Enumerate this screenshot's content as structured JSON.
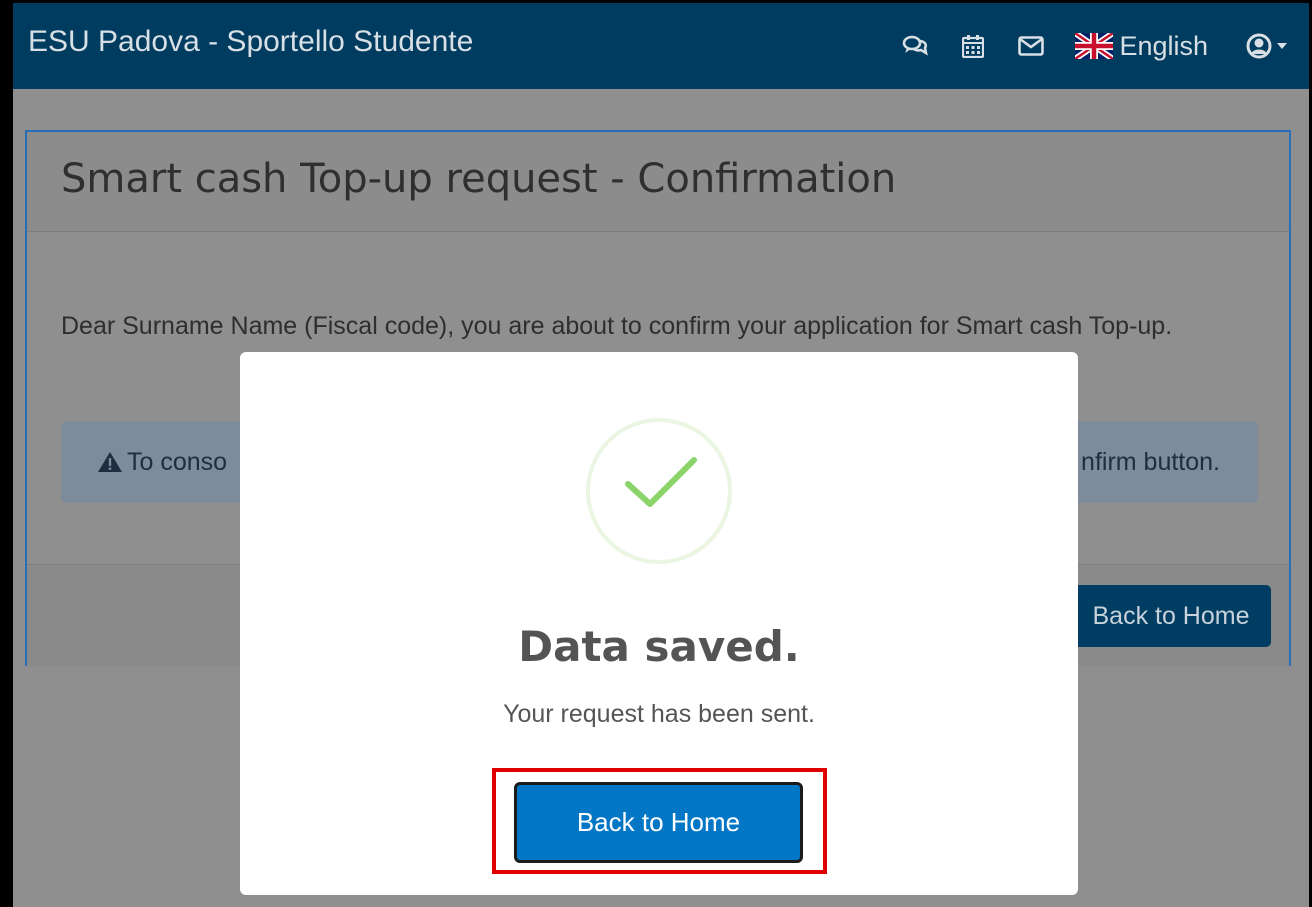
{
  "navbar": {
    "brand": "ESU Padova - Sportello Studente",
    "icons": [
      "chat-icon",
      "calendar-icon",
      "envelope-icon"
    ],
    "language": "English",
    "user_icon": "user-circle-icon"
  },
  "panel": {
    "title": "Smart cash Top-up request - Confirmation",
    "text": "Dear Surname Name (Fiscal code), you are about to confirm your application for Smart cash Top-up.",
    "alert_left": "To conso",
    "alert_right": "nfirm button.",
    "footer_button": "Back to Home"
  },
  "modal": {
    "title": "Data saved.",
    "message": "Your request has been sent.",
    "button": "Back to Home",
    "icon": "check-icon"
  },
  "colors": {
    "navbar_bg": "#003c5f",
    "primary_button": "#0377c6",
    "success": "#8bd46a",
    "highlight": "#e00000"
  }
}
